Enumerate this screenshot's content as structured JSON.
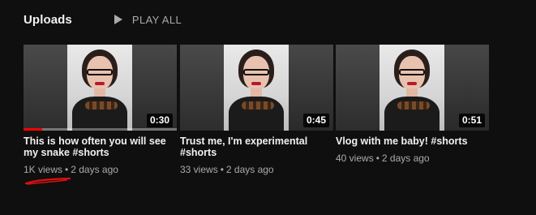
{
  "header": {
    "title": "Uploads",
    "play_all_label": "PLAY ALL"
  },
  "videos": [
    {
      "title": "This is how often you will see my snake #shorts",
      "duration": "0:30",
      "views": "1K views",
      "separator": "•",
      "age": "2 days ago",
      "watch_progress": 0.12
    },
    {
      "title": "Trust me, I'm experimental #shorts",
      "duration": "0:45",
      "views": "33 views",
      "separator": "•",
      "age": "2 days ago"
    },
    {
      "title": "Vlog with me baby! #shorts",
      "duration": "0:51",
      "views": "40 views",
      "separator": "•",
      "age": "2 days ago"
    }
  ],
  "colors": {
    "background": "#0f0f0f",
    "text_primary": "#f1f1f1",
    "text_secondary": "#aaaaaa",
    "progress": "#ff0000",
    "annotation": "#e01010"
  },
  "icons": {
    "play_all": "play-triangle-icon"
  }
}
